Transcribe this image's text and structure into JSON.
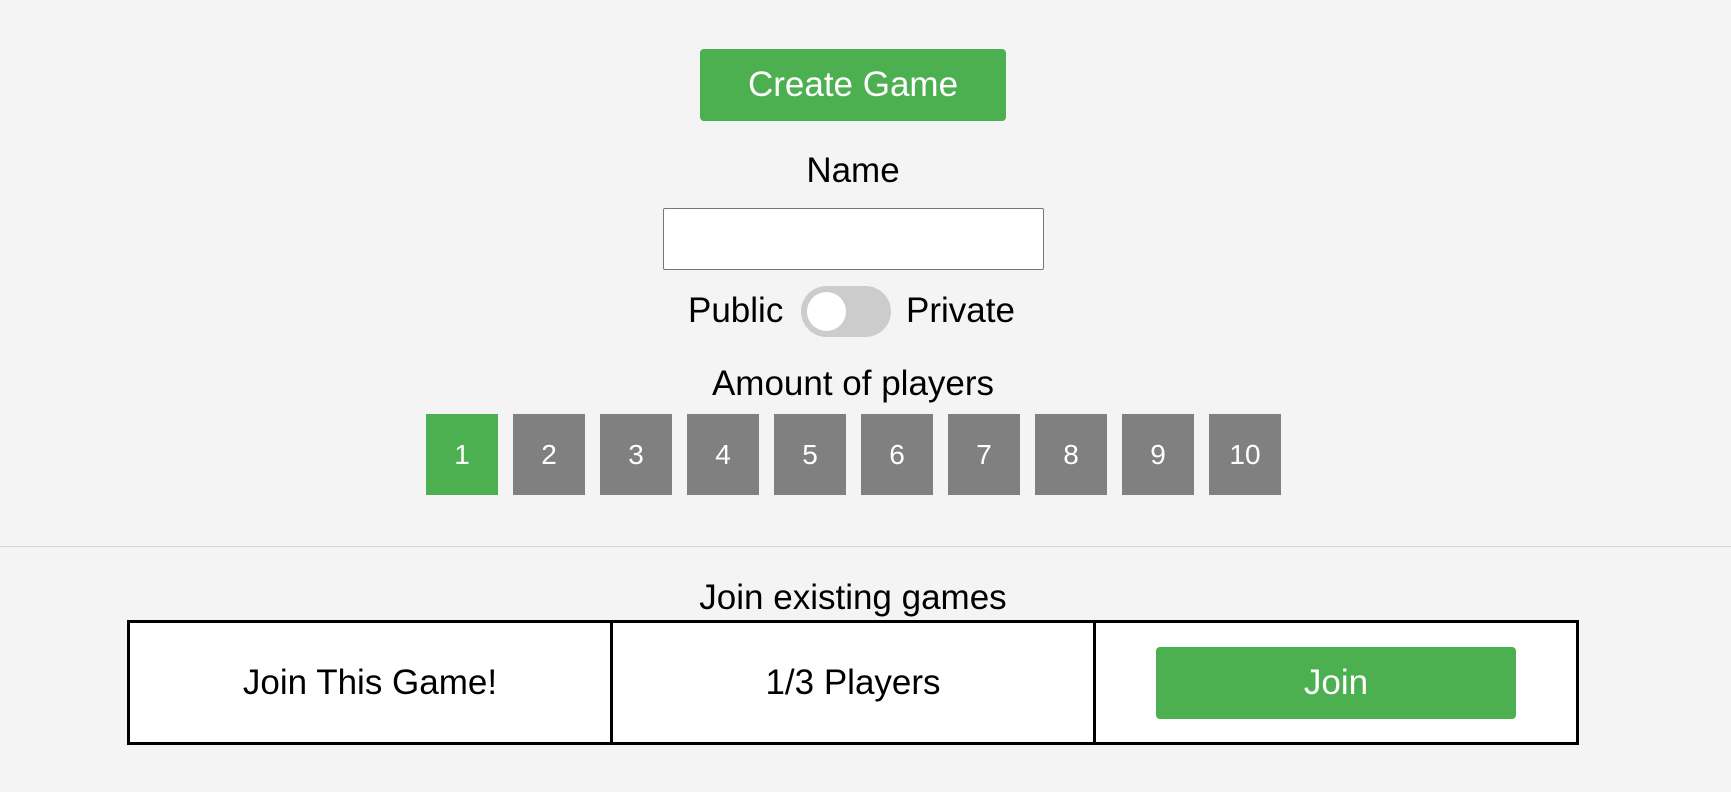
{
  "create": {
    "button_label": "Create Game",
    "name_label": "Name",
    "name_value": "",
    "name_placeholder": "",
    "visibility": {
      "left_label": "Public",
      "right_label": "Private",
      "is_private": false
    },
    "players_label": "Amount of players",
    "player_options": [
      "1",
      "2",
      "3",
      "4",
      "5",
      "6",
      "7",
      "8",
      "9",
      "10"
    ],
    "selected_players": "1"
  },
  "join": {
    "heading": "Join existing games",
    "games": [
      {
        "name": "Join This Game!",
        "players": "1/3 Players",
        "button_label": "Join"
      }
    ]
  },
  "colors": {
    "accent": "#4caf50",
    "option_inactive": "#808080",
    "background": "#f4f4f4",
    "toggle_off": "#cccccc"
  }
}
